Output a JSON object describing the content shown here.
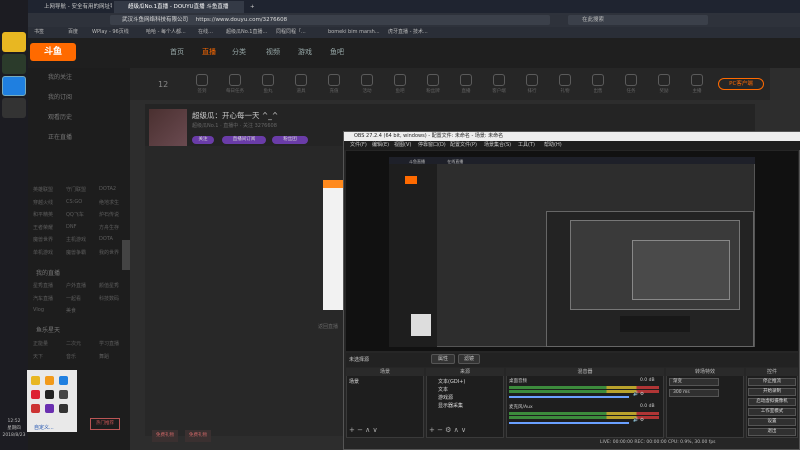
{
  "browser": {
    "tabs": [
      {
        "label": "上网导航 - 安全有用的网址导航",
        "active": false
      },
      {
        "label": "超级瓜No.1直播 - DOUYU直播 斗鱼直播",
        "active": true
      }
    ],
    "url": "https://www.douyu.com/3276608",
    "cert_owner": "武汉斗鱼网络科技有限公司",
    "search_placeholder": "在此搜索",
    "bookmarks": [
      "书签",
      "百度",
      "WPlay - 96页线",
      "哈哈 - 每个人都...",
      "在线…",
      "超级瓜No.1直播...",
      "同程同程「...",
      "bomeki bim marsh...",
      "虎牙直播 - 技术..."
    ]
  },
  "site": {
    "logo": "斗鱼",
    "nav": [
      {
        "label": "首页",
        "active": false
      },
      {
        "label": "直播",
        "active": true
      },
      {
        "label": "分类",
        "active": false
      },
      {
        "label": "视频",
        "active": false
      },
      {
        "label": "游戏",
        "active": false
      },
      {
        "label": "鱼吧",
        "active": false
      }
    ],
    "sidebar_sections": [
      "我的关注",
      "我的订阅",
      "观看历史",
      "正在直播"
    ],
    "sidebar_grid_group1": [
      "英雄联盟",
      "守门联盟",
      "DOTA2",
      "穿越火线",
      "CS:GO",
      "绝地求生",
      "和平精英",
      "QQ飞车",
      "炉石传说",
      "王者荣耀",
      "DNF",
      "方舟生存",
      "魔兽世界",
      "主机游戏",
      "DOTA",
      "单机游戏",
      "魔兽争霸",
      "我的世界"
    ],
    "sidebar_sections2": [
      "我的直播",
      "鱼乐星天"
    ],
    "sidebar_grid_group2": [
      "星秀直播",
      "户外直播",
      "颜值星秀",
      "汽车直播",
      "一起看",
      "科技数码",
      "Vlog",
      "美食"
    ],
    "sidebar_grid_group3": [
      "正能量",
      "二次元",
      "学习直播",
      "天下",
      "音乐",
      "舞蹈"
    ],
    "category_date": "12",
    "categories": [
      "签到",
      "每日任务",
      "鱼丸",
      "道具",
      "充值",
      "活动",
      "鱼吧",
      "粉丝牌",
      "直播",
      "客户端",
      "排行",
      "礼物",
      "出售",
      "任务",
      "奖励",
      "主播"
    ],
    "pc_client_label": "PC客户端",
    "room_title": "超级瓜：开心每一天 ^_^",
    "room_meta": "超级瓜No.1 · 直播中 · 关注 3276608",
    "pills": [
      "关注",
      "直播间订阅",
      "粉丝团"
    ],
    "player_caption": "返回直播",
    "gift_left": "免费礼物",
    "gift_right": "免费礼物"
  },
  "system": {
    "tray_customize": "自定义...",
    "clock_time": "12:52",
    "clock_weekday": "星期四",
    "clock_date": "2018/8/23",
    "orange_tab": "热门推荐"
  },
  "obs": {
    "title": "OBS 27.2.4 (64 bit, windows) - 配置文件: 未命名 - 场景: 未命名",
    "menu": [
      "文件(F)",
      "编辑(E)",
      "视图(V)",
      "停靠窗口(D)",
      "配置文件(P)",
      "场景集合(S)",
      "工具(T)",
      "帮助(H)"
    ],
    "toolbar_label": "未选择源",
    "props_button": "属性",
    "filters_button": "滤镜",
    "docks": {
      "scenes": "场景",
      "sources": "来源",
      "mixer": "混音器",
      "transitions": "转场特效",
      "controls": "控件"
    },
    "scenes_list": [
      "场景"
    ],
    "sources_list": [
      "文本(GDI+)",
      "文本",
      "游戏源",
      "显示器采集"
    ],
    "mixer": [
      {
        "name": "桌面音频",
        "level": "0.0 dB"
      },
      {
        "name": "麦克风/Aux",
        "level": "0.0 dB"
      }
    ],
    "transition": "渐变",
    "duration_label": "时长",
    "duration": "300 ms",
    "controls": [
      "停止推流",
      "开始录制",
      "启动虚拟摄像机",
      "工作室模式",
      "设置",
      "退出"
    ],
    "status": "LIVE: 00:00:00   REC: 00:00:00   CPU: 0.9%, 30.00 fps",
    "nested_tabs": [
      "斗鱼直播",
      "在线直播"
    ]
  }
}
